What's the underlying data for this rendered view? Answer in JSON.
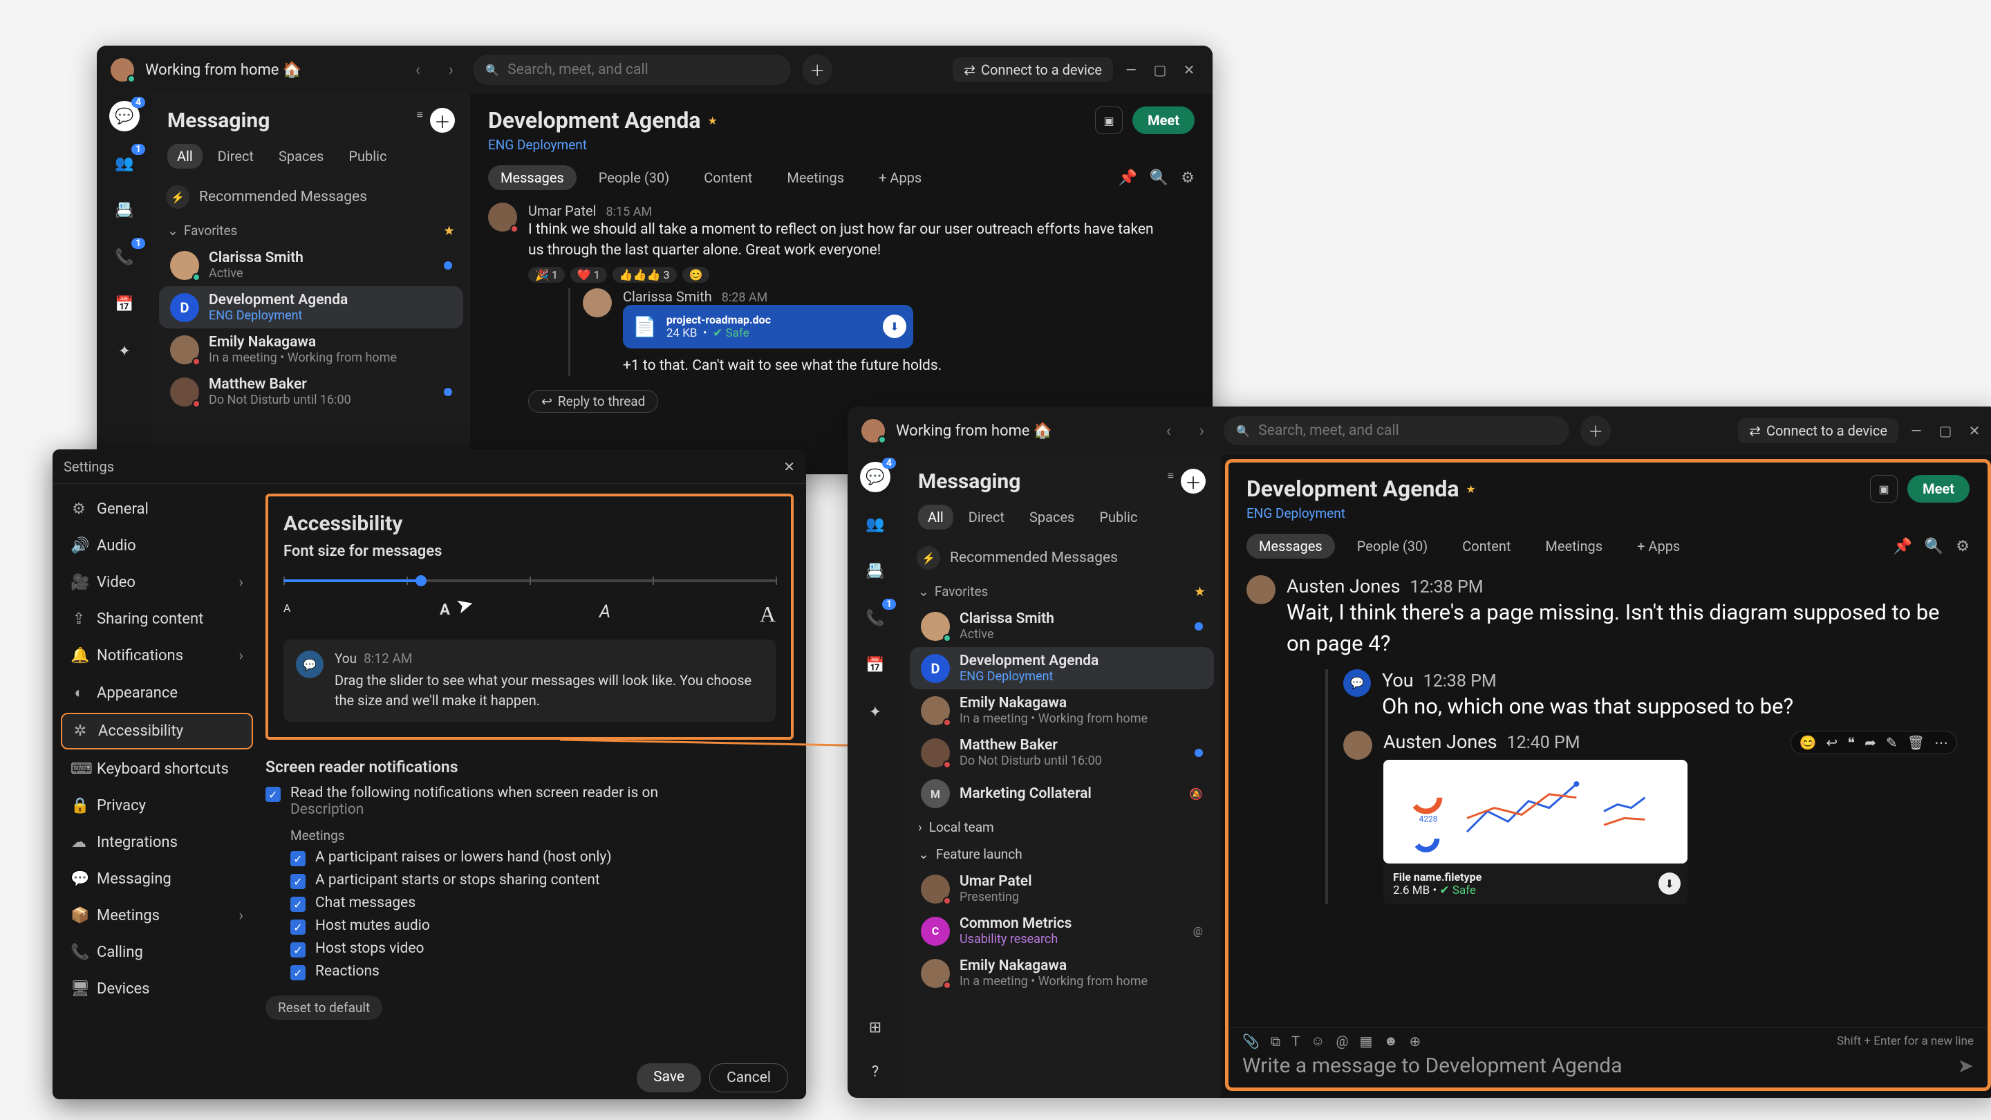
{
  "titlebar": {
    "status": "Working from home 🏠",
    "search_placeholder": "Search, meet, and call",
    "connect": "Connect to a device"
  },
  "rail": {
    "chat_badge": "4",
    "teams_badge": "1",
    "contacts_badge": "1"
  },
  "list": {
    "title": "Messaging",
    "pills": {
      "all": "All",
      "direct": "Direct",
      "spaces": "Spaces",
      "public": "Public"
    },
    "recommended": "Recommended Messages",
    "favorites_label": "Favorites",
    "convos": [
      {
        "name": "Clarissa Smith",
        "sub": "Active"
      },
      {
        "name": "Development Agenda",
        "sub": "ENG Deployment"
      },
      {
        "name": "Emily Nakagawa",
        "sub": "In a meeting  •  Working from home"
      },
      {
        "name": "Matthew Baker",
        "sub": "Do Not Disturb until 16:00"
      },
      {
        "name": "Marketing Collateral",
        "sub": ""
      },
      {
        "name": "Umar Patel",
        "sub": "Presenting"
      },
      {
        "name": "Common Metrics",
        "sub": "Usability research"
      },
      {
        "name": "Emily Nakagawa",
        "sub": "In a meeting  •  Working from home"
      }
    ],
    "local_team": "Local team",
    "feature_launch": "Feature launch"
  },
  "chat1": {
    "title": "Development Agenda",
    "team": "ENG Deployment",
    "meet": "Meet",
    "tabs": {
      "messages": "Messages",
      "people": "People (30)",
      "content": "Content",
      "meetings": "Meetings",
      "apps": "+  Apps"
    },
    "m1": {
      "author": "Umar Patel",
      "time": "8:15 AM",
      "body": "I think we should all take a moment to reflect on just how far our user outreach efforts have taken us through the last quarter alone. Great work everyone!",
      "reacts": [
        "🎉 1",
        "❤️ 1",
        "👍👍👍 3",
        "😊"
      ]
    },
    "reply_header": {
      "author": "Clarissa Smith",
      "time": "8:28 AM"
    },
    "file": {
      "name": "project-roadmap.doc",
      "size": "24 KB",
      "safe": "Safe"
    },
    "reply_body": "+1 to that. Can't wait to see what the future holds.",
    "reply_btn": "Reply to thread"
  },
  "settings": {
    "title": "Settings",
    "nav": [
      "General",
      "Audio",
      "Video",
      "Sharing content",
      "Notifications",
      "Appearance",
      "Accessibility",
      "Keyboard shortcuts",
      "Privacy",
      "Integrations",
      "Messaging",
      "Meetings",
      "Calling",
      "Devices"
    ],
    "acc": {
      "heading": "Accessibility",
      "font_label": "Font size for messages",
      "a": "A",
      "preview_name": "You",
      "preview_time": "8:12 AM",
      "preview_body": "Drag the slider to see what your messages will look like. You choose the size and we'll make it happen.",
      "scr_heading": "Screen reader notifications",
      "scr_desc": "Read the following notifications when screen reader is on",
      "scr_desc2": "Description",
      "meetings_label": "Meetings",
      "opts": [
        "A participant raises or lowers hand (host only)",
        "A participant starts or stops sharing content",
        "Chat messages",
        "Host mutes audio",
        "Host stops video",
        "Reactions"
      ],
      "reset": "Reset to default",
      "save": "Save",
      "cancel": "Cancel"
    }
  },
  "chat2": {
    "m1": {
      "author": "Austen Jones",
      "time": "12:38 PM",
      "body": "Wait, I think there's a page missing. Isn't this diagram supposed to be on page 4?"
    },
    "m2": {
      "author": "You",
      "time": "12:38 PM",
      "body": "Oh no, which one was that supposed to be?"
    },
    "m3": {
      "author": "Austen Jones",
      "time": "12:40 PM"
    },
    "file": {
      "name": "File name.filetype",
      "size": "2.6 MB",
      "safe": "Safe"
    },
    "compose": {
      "hint": "Shift + Enter for a new line",
      "placeholder": "Write a message to Development Agenda"
    }
  }
}
